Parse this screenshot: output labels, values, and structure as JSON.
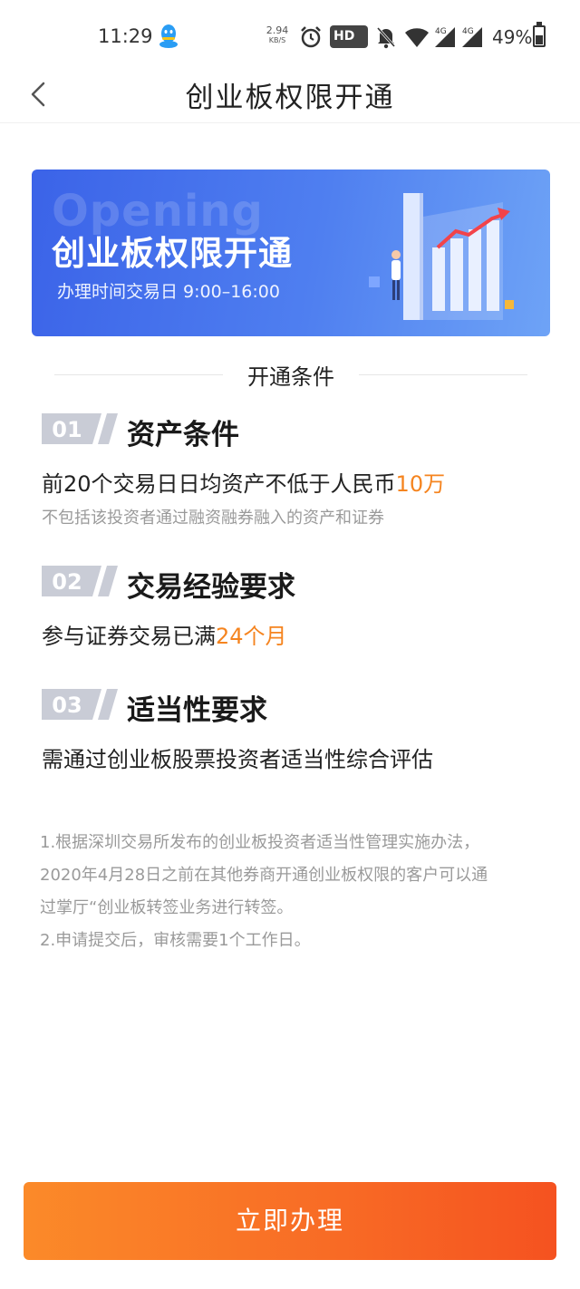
{
  "status_bar": {
    "time": "11:29",
    "speed_value": "2.94",
    "speed_unit": "KB/S",
    "hd_label": "HD",
    "net_labels": [
      "4G",
      "4G"
    ],
    "battery_text": "49%",
    "battery_level": 0.49,
    "icons": [
      "qq-icon",
      "alarm-icon",
      "hd-icon",
      "mute-bell-icon",
      "wifi-icon",
      "signal-icon",
      "signal-icon",
      "battery-icon"
    ]
  },
  "nav": {
    "title": "创业板权限开通",
    "back_icon": "chevron-left-icon"
  },
  "banner": {
    "bg_text": "Opening",
    "title": "创业板权限开通",
    "subtitle": "办理时间交易日 9:00–16:00"
  },
  "section_title": "开通条件",
  "conditions": [
    {
      "number": "01",
      "title": "资产条件",
      "main_prefix": "前20个交易日日均资产不低于人民币",
      "main_highlight": "10万",
      "note": "不包括该投资者通过融资融券融入的资产和证券"
    },
    {
      "number": "02",
      "title": "交易经验要求",
      "main_prefix": "参与证券交易已满",
      "main_highlight": "24个月"
    },
    {
      "number": "03",
      "title": "适当性要求",
      "main_prefix": "需通过创业板股票投资者适当性综合评估"
    }
  ],
  "notes": [
    "1.根据深圳交易所发布的创业板投资者适当性管理实施办法，",
    "2020年4月28日之前在其他券商开通创业板权限的客户可以通",
    "过掌厅“创业板转签业务进行转签。",
    "2.申请提交后，审核需要1个工作日。"
  ],
  "apply_button": "立即办理",
  "colors": {
    "highlight": "#f5841f",
    "banner_blue": "#4f7ff0",
    "button_orange": "#f86a25",
    "note_gray": "#9a9a9a"
  }
}
